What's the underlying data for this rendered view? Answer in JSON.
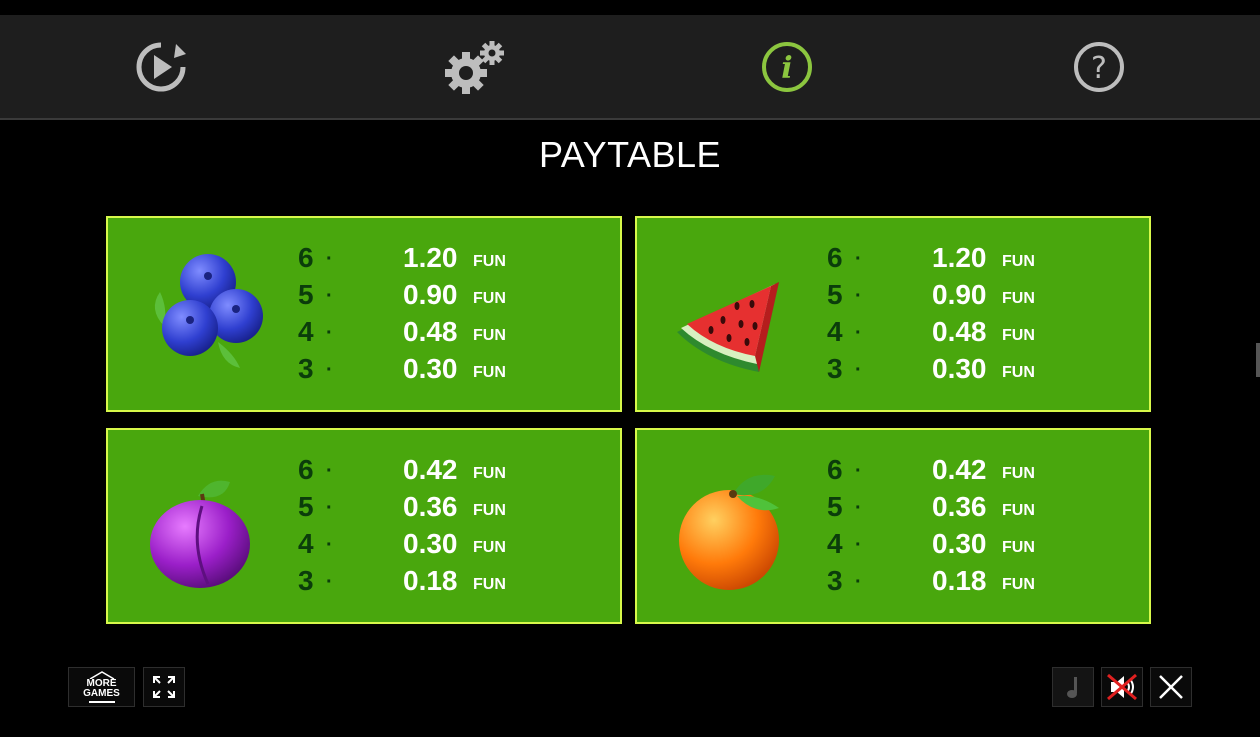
{
  "title": "PAYTABLE",
  "topbar": {
    "buttons": [
      {
        "name": "autoplay-icon"
      },
      {
        "name": "settings-icon"
      },
      {
        "name": "info-icon",
        "active": true
      },
      {
        "name": "help-icon"
      }
    ]
  },
  "currency": "FUN",
  "colors": {
    "panel": "#49a70d",
    "panel_border": "#d7f94a",
    "active_icon": "#8cc63f"
  },
  "symbols": [
    {
      "name": "blueberries",
      "rows": [
        {
          "count": "6",
          "value": "1.20"
        },
        {
          "count": "5",
          "value": "0.90"
        },
        {
          "count": "4",
          "value": "0.48"
        },
        {
          "count": "3",
          "value": "0.30"
        }
      ]
    },
    {
      "name": "watermelon",
      "rows": [
        {
          "count": "6",
          "value": "1.20"
        },
        {
          "count": "5",
          "value": "0.90"
        },
        {
          "count": "4",
          "value": "0.48"
        },
        {
          "count": "3",
          "value": "0.30"
        }
      ]
    },
    {
      "name": "plum",
      "rows": [
        {
          "count": "6",
          "value": "0.42"
        },
        {
          "count": "5",
          "value": "0.36"
        },
        {
          "count": "4",
          "value": "0.30"
        },
        {
          "count": "3",
          "value": "0.18"
        }
      ]
    },
    {
      "name": "orange",
      "rows": [
        {
          "count": "6",
          "value": "0.42"
        },
        {
          "count": "5",
          "value": "0.36"
        },
        {
          "count": "4",
          "value": "0.30"
        },
        {
          "count": "3",
          "value": "0.18"
        }
      ]
    }
  ],
  "footer": {
    "more_games_line1": "MORE",
    "more_games_line2": "GAMES"
  }
}
